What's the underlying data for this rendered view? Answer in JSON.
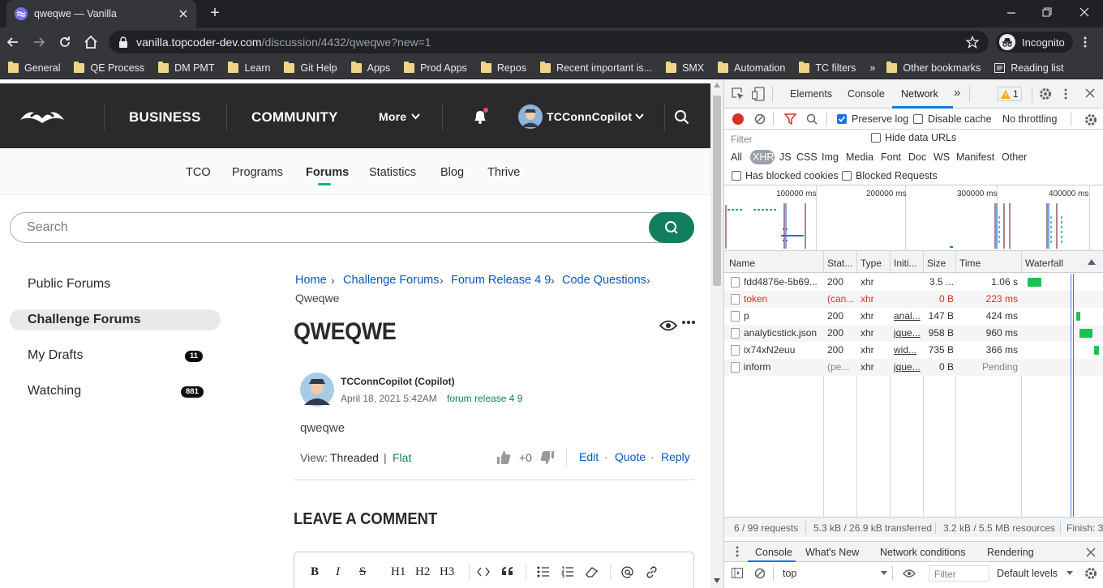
{
  "browser": {
    "tab_title": "qweqwe — Vanilla",
    "url_host": "vanilla.topcoder-dev.com",
    "url_path": "/discussion/4432/qweqwe?new=1",
    "incognito_label": "Incognito",
    "bookmarks": [
      "General",
      "QE Process",
      "DM PMT",
      "Learn",
      "Git Help",
      "Apps",
      "Prod Apps",
      "Repos",
      "Recent important is...",
      "SMX",
      "Automation",
      "TC filters"
    ],
    "more_bookmarks": "»",
    "other_bookmarks": "Other bookmarks",
    "reading_list": "Reading list"
  },
  "site": {
    "nav": {
      "business": "BUSINESS",
      "community": "COMMUNITY",
      "more": "More",
      "username": "TCConnCopilot"
    },
    "subnav": [
      "TCO",
      "Programs",
      "Forums",
      "Statistics",
      "Blog",
      "Thrive"
    ],
    "search_placeholder": "Search",
    "sidebar": [
      {
        "label": "Public Forums",
        "badge": ""
      },
      {
        "label": "Challenge Forums",
        "badge": ""
      },
      {
        "label": "My Drafts",
        "badge": "11"
      },
      {
        "label": "Watching",
        "badge": "881"
      }
    ],
    "breadcrumbs": [
      "Home",
      "Challenge Forums",
      "Forum Release 4 9",
      "Code Questions"
    ],
    "breadcrumb_current": "Qweqwe",
    "title": "QWEQWE",
    "post": {
      "author": "TCConnCopilot (Copilot)",
      "date": "April 18, 2021 5:42AM",
      "category": "forum release 4 9",
      "body": "qweqwe",
      "view_label": "View:",
      "threaded": "Threaded",
      "divider": "|",
      "flat": "Flat",
      "score": "+0",
      "edit": "Edit",
      "quote": "Quote",
      "reply": "Reply",
      "dot": "·"
    },
    "leave_comment": "LEAVE A COMMENT",
    "editor_tools": [
      "B",
      "I",
      "S",
      "H1",
      "H2",
      "H3"
    ]
  },
  "devtools": {
    "tabs": [
      "Elements",
      "Console",
      "Network"
    ],
    "active_tab": "Network",
    "warnings": "1",
    "preserve_log": "Preserve log",
    "disable_cache": "Disable cache",
    "throttling": "No throttling",
    "filter_placeholder": "Filter",
    "hide_data_urls": "Hide data URLs",
    "types": [
      "All",
      "XHR",
      "JS",
      "CSS",
      "Img",
      "Media",
      "Font",
      "Doc",
      "WS",
      "Manifest",
      "Other"
    ],
    "has_blocked_cookies": "Has blocked cookies",
    "blocked_requests": "Blocked Requests",
    "timeline_ticks": [
      "100000 ms",
      "200000 ms",
      "300000 ms",
      "400000 ms"
    ],
    "columns": [
      "Name",
      "Stat...",
      "Type",
      "Initi...",
      "Size",
      "Time",
      "Waterfall"
    ],
    "rows": [
      {
        "name": "fdd4876e-5b69...",
        "status": "200",
        "type": "xhr",
        "initiator": "",
        "size": "3.5 ...",
        "time": "1.06 s",
        "error": false,
        "bar_start": 0.08,
        "bar_width": 0.17
      },
      {
        "name": "token",
        "status": "(can...",
        "type": "xhr",
        "initiator": "",
        "size": "0 B",
        "time": "223 ms",
        "error": true,
        "bar_start": 0,
        "bar_width": 0
      },
      {
        "name": "p",
        "status": "200",
        "type": "xhr",
        "initiator": "anal...",
        "size": "147 B",
        "time": "424 ms",
        "error": false,
        "bar_start": 0.67,
        "bar_width": 0.05
      },
      {
        "name": "analyticstick.json",
        "status": "200",
        "type": "xhr",
        "initiator": "jque...",
        "size": "958 B",
        "time": "960 ms",
        "error": false,
        "bar_start": 0.71,
        "bar_width": 0.15
      },
      {
        "name": "ix74xN2euu",
        "status": "200",
        "type": "xhr",
        "initiator": "wid...",
        "size": "735 B",
        "time": "366 ms",
        "error": false,
        "bar_start": 0.88,
        "bar_width": 0.06
      },
      {
        "name": "inform",
        "status": "(pe...",
        "type": "xhr",
        "initiator": "jque...",
        "size": "0 B",
        "time": "Pending",
        "error": false,
        "bar_start": 0,
        "bar_width": 0
      }
    ],
    "summary": {
      "requests": "6 / 99 requests",
      "transferred": "5.3 kB / 26.9 kB transferred",
      "resources": "3.2 kB / 5.5 MB resources",
      "finish": "Finish: 3"
    },
    "drawer_tabs": [
      "Console",
      "What's New",
      "Network conditions",
      "Rendering"
    ],
    "context": "top",
    "drawer_filter": "Filter",
    "levels": "Default levels"
  }
}
